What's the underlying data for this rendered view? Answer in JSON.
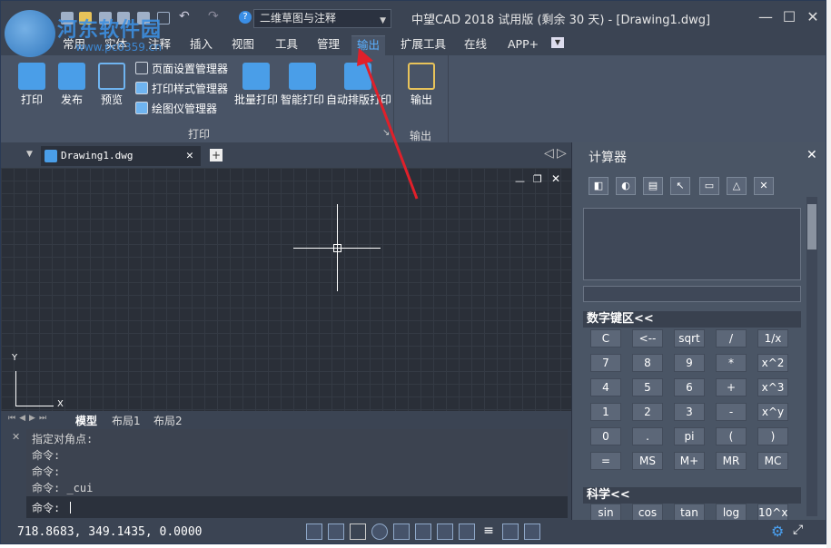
{
  "titlebar": {
    "workspace": "二维草图与注释",
    "window_title": "中望CAD 2018 试用版 (剩余 30 天) - [Drawing1.dwg]"
  },
  "menu_tabs": [
    "常用",
    "实体",
    "注释",
    "插入",
    "视图",
    "工具",
    "管理",
    "输出",
    "扩展工具",
    "在线",
    "APP+"
  ],
  "active_tab": "输出",
  "ribbon": {
    "print_group": {
      "print": "打印",
      "publish": "发布",
      "preview": "预览",
      "page_setup_manager": "页面设置管理器",
      "plot_style_manager": "打印样式管理器",
      "plotter_manager": "绘图仪管理器",
      "batch_plot": "批量打印",
      "smart_plot": "智能打印",
      "auto_layout_plot": "自动排版打印",
      "panel_label": "打印"
    },
    "output_group": {
      "output": "输出",
      "panel_label": "输出"
    }
  },
  "document": {
    "tab_label": "Drawing1.dwg"
  },
  "layout_tabs": [
    "模型",
    "布局1",
    "布局2"
  ],
  "command": {
    "history": [
      "指定对角点:",
      "命令:",
      "命令:",
      "命令: _cui"
    ],
    "prompt": "命令:"
  },
  "calculator": {
    "title": "计算器",
    "numpad_section": "数字键区<<",
    "numpad_keys": [
      [
        "C",
        "<--",
        "sqrt",
        "/",
        "1/x"
      ],
      [
        "7",
        "8",
        "9",
        "*",
        "x^2"
      ],
      [
        "4",
        "5",
        "6",
        "+",
        "x^3"
      ],
      [
        "1",
        "2",
        "3",
        "-",
        "x^y"
      ],
      [
        "0",
        ".",
        "pi",
        "(",
        ")"
      ],
      [
        "=",
        "MS",
        "M+",
        "MR",
        "MC"
      ]
    ],
    "science_section": "科学<<",
    "science_keys": [
      "sin",
      "cos",
      "tan",
      "log",
      "10^x"
    ]
  },
  "statusbar": {
    "coordinates": "718.8683, 349.1435, 0.0000"
  },
  "axis": {
    "x": "X",
    "y": "Y"
  },
  "watermark": {
    "site": "河东软件园",
    "url": "www.pc0359.cn"
  },
  "colors": {
    "accent": "#5ab0ff",
    "arrow": "#e0202a"
  }
}
